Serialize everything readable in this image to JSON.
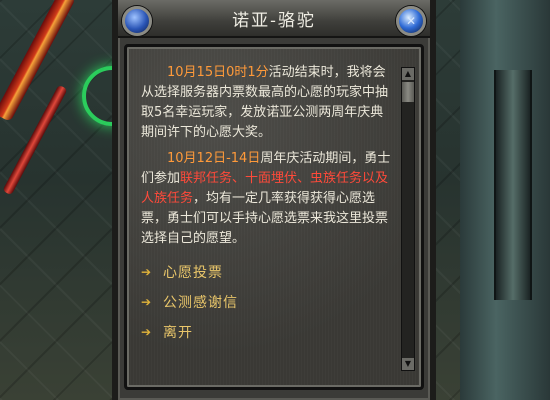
{
  "dialog": {
    "title": "诺亚-骆驼",
    "paragraph1": {
      "date_highlight": "10月15日0时1分",
      "text": "活动结束时，我将会从选择服务器内票数最高的心愿的玩家中抽取5名幸运玩家，发放诺亚公测两周年庆典期间许下的心愿大奖。"
    },
    "paragraph2": {
      "date_highlight": "10月12日-14日",
      "text_a": "周年庆活动期间，勇士们参加",
      "task_highlight": "联邦任务、十面埋伏、虫族任务以及人族任务",
      "text_b": "，均有一定几率获得获得心愿选票，勇士们可以手持心愿选票来我这里投票选择自己的愿望。"
    },
    "options": [
      {
        "label": "心愿投票"
      },
      {
        "label": "公测感谢信"
      },
      {
        "label": "离开"
      }
    ],
    "icons": {
      "left_orb": "blue-orb-icon",
      "right_orb": "close-orb-icon",
      "option_arrow": "arrow-right-icon"
    }
  }
}
